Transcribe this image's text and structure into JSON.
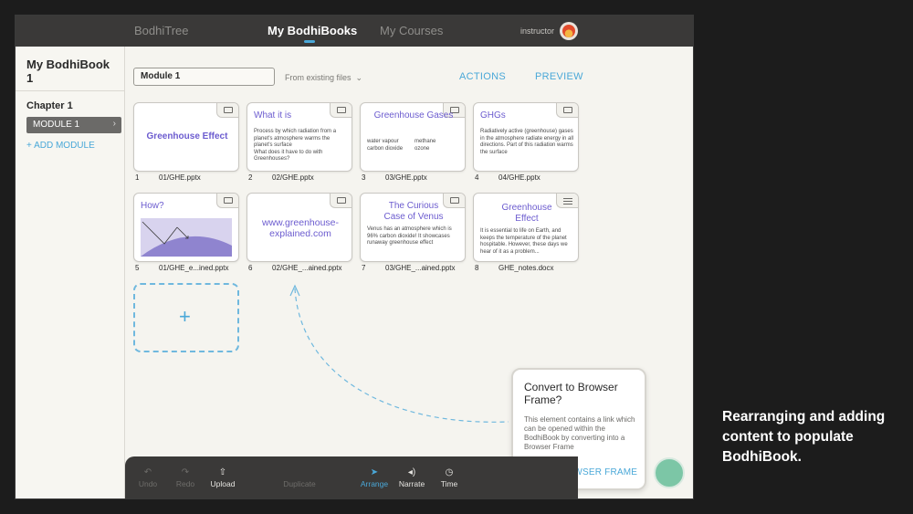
{
  "topnav": {
    "items": [
      {
        "label": "BodhiTree"
      },
      {
        "label": "My BodhiBooks"
      },
      {
        "label": "My Courses"
      }
    ],
    "role": "instructor",
    "accent": "#4aa8d8"
  },
  "sidebar": {
    "book_title": "My BodhiBook 1",
    "chapter": "Chapter 1",
    "module_item": "MODULE 1",
    "add_module": "+ ADD MODULE"
  },
  "editor": {
    "module_name": "Module 1",
    "from_existing": "From existing files",
    "actions": "ACTIONS",
    "preview": "PREVIEW"
  },
  "cards": [
    {
      "index": "1",
      "file": "01/GHE.pptx",
      "title": "Greenhouse Effect",
      "icon": "slide-icon"
    },
    {
      "index": "2",
      "file": "02/GHE.pptx",
      "title": "What it is",
      "body": "Process by which radiation from a planet's atmosphere warms the planet's surface\nWhat does it have to do with Greenhouses?",
      "icon": "slide-icon"
    },
    {
      "index": "3",
      "file": "03/GHE.pptx",
      "title": "Greenhouse Gases",
      "col1": "water vapour",
      "col2": "methane",
      "col3": "carbon dioxide",
      "col4": "ozone",
      "icon": "slide-icon"
    },
    {
      "index": "4",
      "file": "04/GHE.pptx",
      "title": "GHGs",
      "body": "Radiatively active (greenhouse) gases in the atmosphere radiate energy in all directions. Part of this radiation warms the surface",
      "icon": "slide-icon"
    },
    {
      "index": "5",
      "file": "01/GHE_e...ined.pptx",
      "title": "How?",
      "icon": "slide-icon"
    },
    {
      "index": "6",
      "file": "02/GHE_...ained.pptx",
      "title": "www.greenhouse-explained.com",
      "icon": "slide-icon"
    },
    {
      "index": "7",
      "file": "03/GHE_...ained.pptx",
      "title": "The Curious Case of Venus",
      "body": "Venus has an atmosphere which is 96% carbon dioxide! It showcases runaway greenhouse effect",
      "icon": "slide-icon"
    },
    {
      "index": "8",
      "file": "GHE_notes.docx",
      "title": "Greenhouse Effect",
      "body": "It is essential to life on Earth, and keeps the temperature of the planet hospitable. However, these days we hear of it as a problem...",
      "icon": "document-icon"
    }
  ],
  "add_tile": {
    "symbol": "+"
  },
  "popover": {
    "title": "Convert to Browser Frame?",
    "body": "This element contains a link which can be opened within the BodhiBook by converting into a Browser Frame",
    "action": "MAKE BROWSER FRAME"
  },
  "toolbar": {
    "undo": "Undo",
    "redo": "Redo",
    "upload": "Upload",
    "duplicate": "Duplicate",
    "arrange": "Arrange",
    "narrate": "Narrate",
    "time": "Time"
  },
  "caption": "Rearranging and adding content to populate BodhiBook."
}
